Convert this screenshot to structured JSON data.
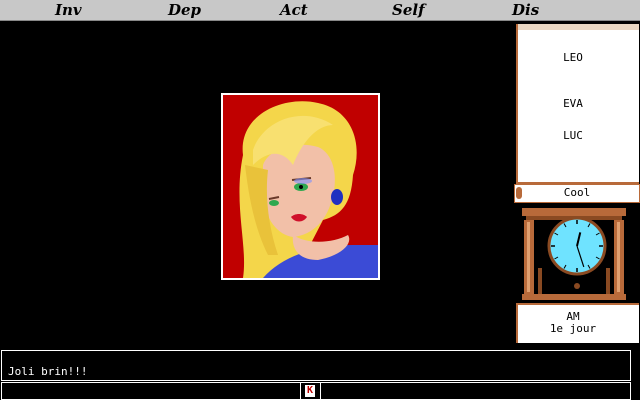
{
  "menu": {
    "items": [
      "Inv",
      "Dep",
      "Act",
      "Self",
      "Dis"
    ]
  },
  "characters": [
    "LEO",
    "EVA",
    "LUC"
  ],
  "mood": "Cool",
  "clock": {
    "hour": 12,
    "minute": 27
  },
  "time_label": {
    "period": "AM",
    "day": "1e jour"
  },
  "dialog": {
    "text": "Joli brin!!!"
  },
  "input": {
    "cursor_glyph": "K"
  },
  "colors": {
    "menu_bg": "#c8c8c8",
    "portrait_bg": "#c00000",
    "wood": "#b86a3a",
    "clock_face": "#6fe3ff"
  }
}
